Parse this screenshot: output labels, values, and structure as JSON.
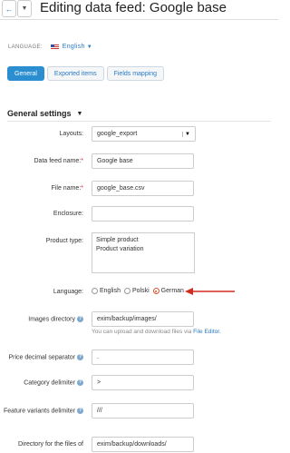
{
  "header": {
    "title": "Editing data feed: Google base",
    "back_icon": "arrow-left-icon",
    "menu_icon": "chevron-down-icon"
  },
  "language": {
    "label": "LANGUAGE:",
    "value": "English"
  },
  "tabs": [
    {
      "label": "General",
      "active": true
    },
    {
      "label": "Exported items",
      "active": false
    },
    {
      "label": "Fields mapping",
      "active": false
    }
  ],
  "section": {
    "title": "General settings"
  },
  "form": {
    "layouts": {
      "label": "Layouts:",
      "value": "google_export"
    },
    "data_feed_name": {
      "label": "Data feed name:",
      "required": "*",
      "value": "Google base"
    },
    "file_name": {
      "label": "File name:",
      "required": "*",
      "value": "google_base.csv"
    },
    "enclosure": {
      "label": "Enclosure:",
      "value": ""
    },
    "product_type": {
      "label": "Product type:",
      "options": [
        "Simple product",
        "Product variation"
      ]
    },
    "lang": {
      "label": "Language:",
      "options": [
        "English",
        "Polski",
        "German"
      ],
      "selected": "German"
    },
    "images_directory": {
      "label": "Images directory",
      "value": "exim/backup/images/",
      "hint": "You can upload and download files via",
      "hint_link": "File Editor."
    },
    "price_decimal_separator": {
      "label": "Price decimal separator",
      "value": "."
    },
    "category_delimiter": {
      "label": "Category delimiter",
      "value": ">"
    },
    "feature_variants_delimiter": {
      "label": "Feature variants delimiter",
      "value": "///"
    },
    "files_directory": {
      "label": "Directory for the files of",
      "value": "exim/backup/downloads/"
    }
  },
  "colors": {
    "accent": "#2a8ed1",
    "arrow": "#d32b1e"
  }
}
